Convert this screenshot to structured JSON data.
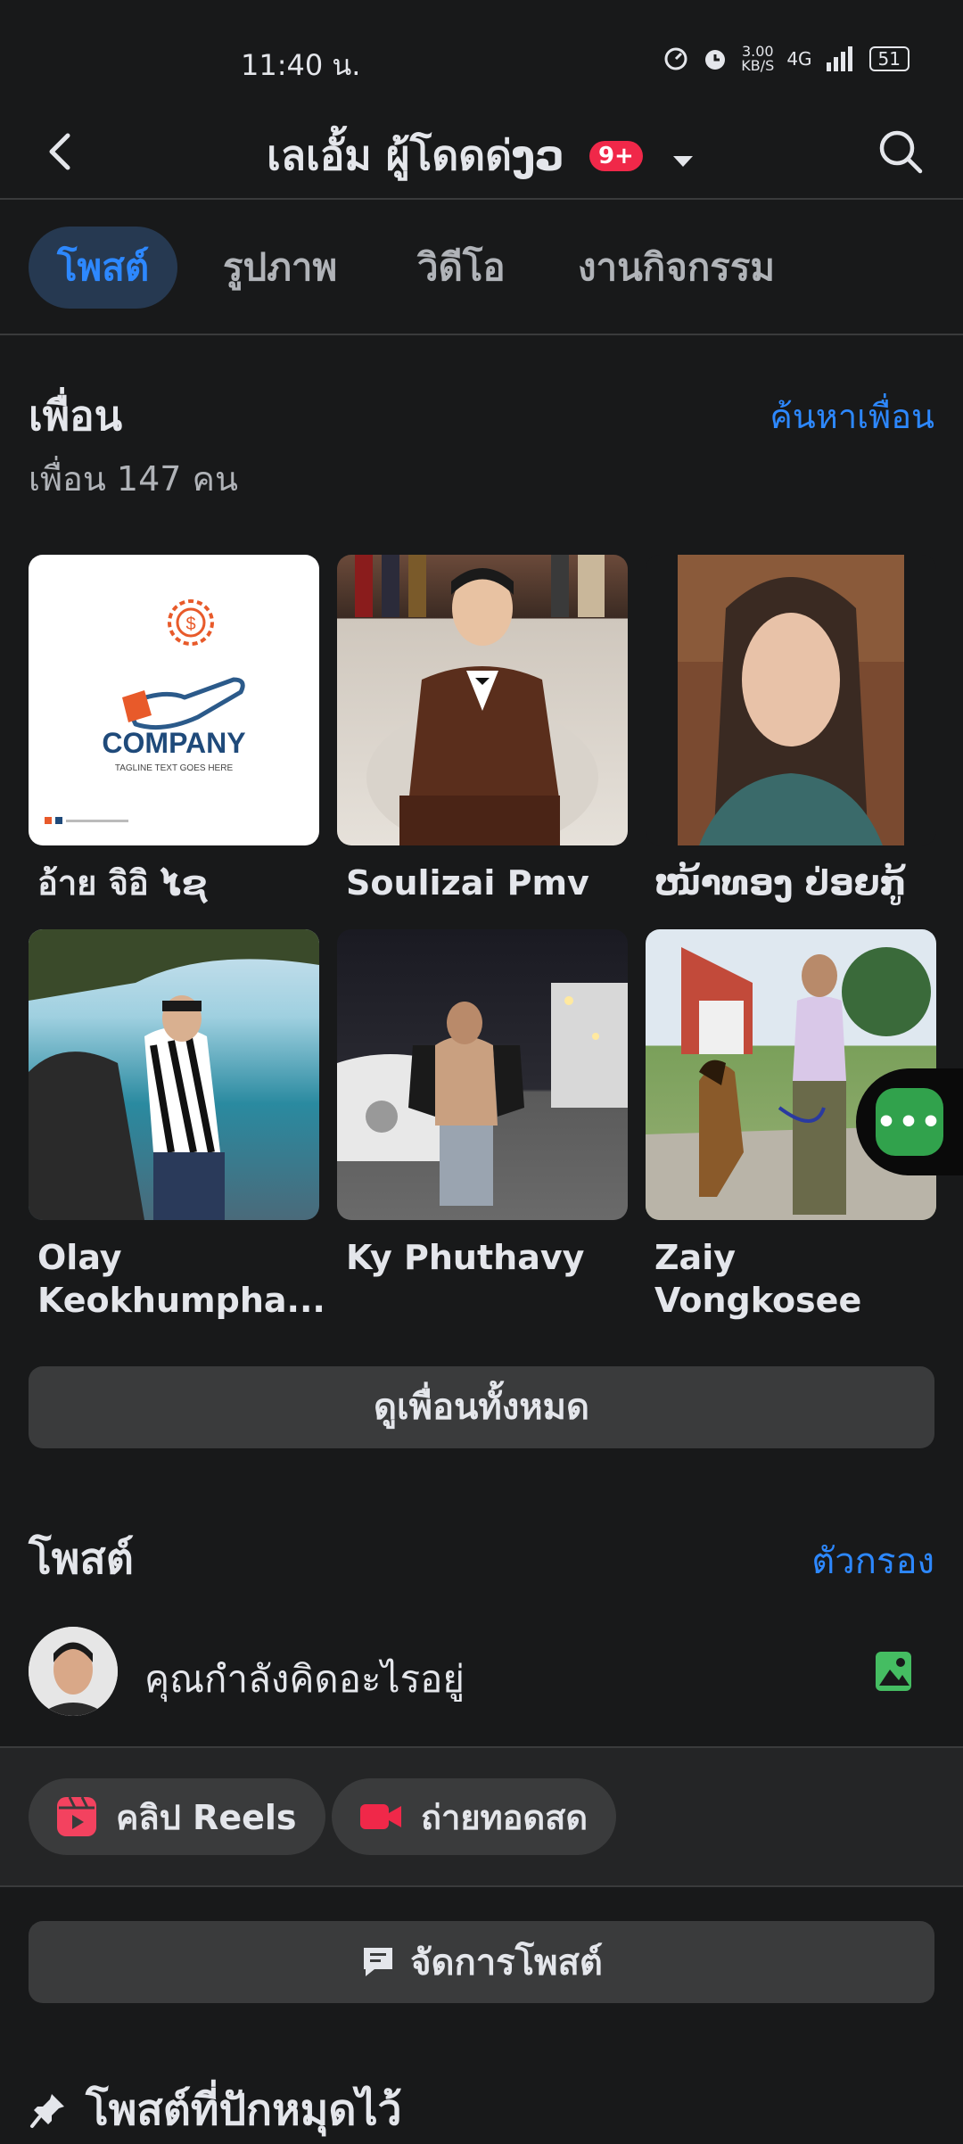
{
  "status": {
    "time": "11:40 น.",
    "speed": "3.00",
    "speed_unit": "KB/S",
    "network": "4G",
    "battery": "51"
  },
  "header": {
    "title": "เลเอั้ม ผู้โดดด่ງວ",
    "badge": "9+"
  },
  "tabs": [
    {
      "label": "โพสต์",
      "active": true
    },
    {
      "label": "รูปภาพ",
      "active": false
    },
    {
      "label": "วิดีโอ",
      "active": false
    },
    {
      "label": "งานกิจกรรม",
      "active": false
    }
  ],
  "friends": {
    "heading": "เพื่อน",
    "count_label": "เพื่อน 147 คน",
    "find_label": "ค้นหาเพื่อน",
    "see_all_label": "ดูเพื่อนทั้งหมด",
    "list": [
      {
        "name": "อ้าย จิอิ ໄຊ",
        "photo": "company-logo"
      },
      {
        "name": "Soulizai Pmv",
        "photo": "man-in-suit"
      },
      {
        "name": "ໜ້າທອງ ປ່ອຍກູ້",
        "photo": "woman-portrait"
      },
      {
        "name": "Olay Keokhumpha...",
        "photo": "man-at-sea"
      },
      {
        "name": "Ky Phuthavy",
        "photo": "man-by-car"
      },
      {
        "name": "Zaiy Vongkosee",
        "photo": "man-with-dog"
      }
    ],
    "company_logo_text": {
      "brand": "COMPANY",
      "tagline": "TAGLINE TEXT GOES HERE"
    }
  },
  "posts": {
    "heading": "โพสต์",
    "filter_label": "ตัวกรอง",
    "composer_placeholder": "คุณกำลังคิดอะไรอยู่",
    "reels_label": "คลิป Reels",
    "live_label": "ถ่ายทอดสด",
    "manage_label": "จัดการโพสต์",
    "pinned_label": "โพสต์ที่ปักหมุดไว้"
  },
  "colors": {
    "background": "#18191a",
    "accent": "#2d88ff",
    "badge": "#f02849",
    "reels": "#f3425f",
    "photo_icon": "#45bd62"
  }
}
